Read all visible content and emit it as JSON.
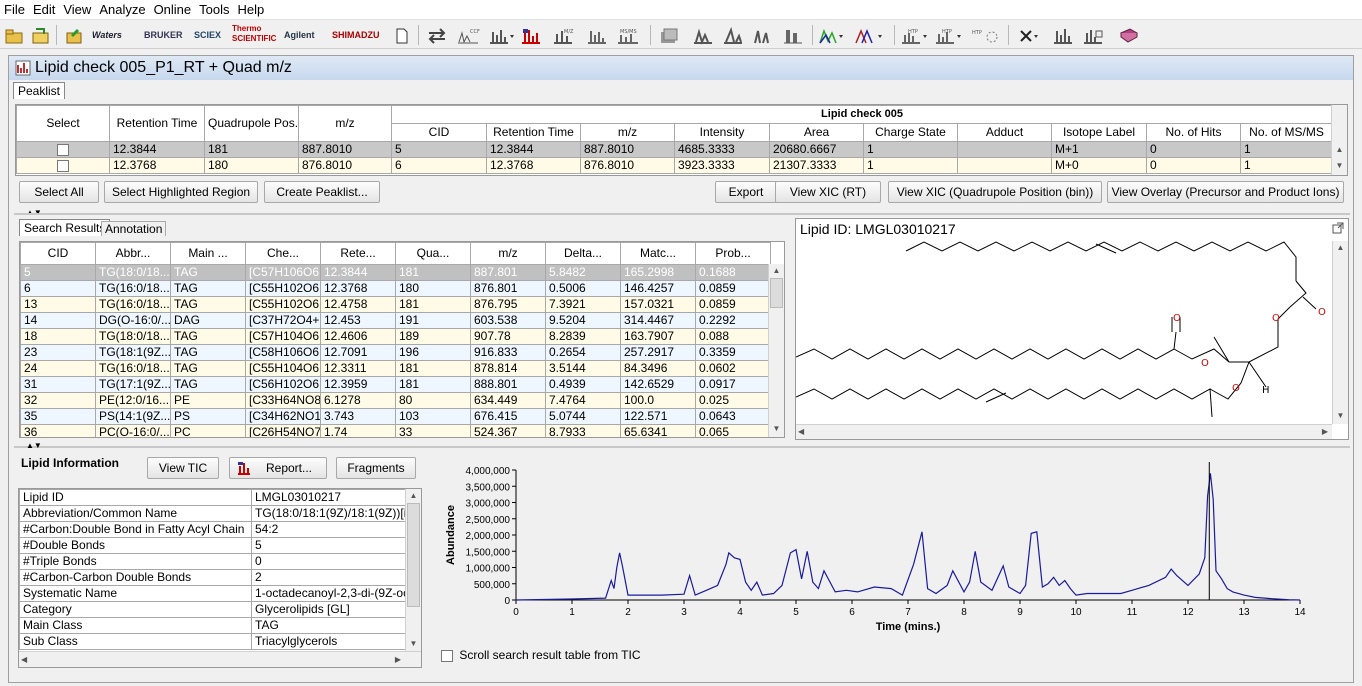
{
  "menu": [
    "File",
    "Edit",
    "View",
    "Analyze",
    "Online",
    "Tools",
    "Help"
  ],
  "toolbar": {
    "waters": "Waters",
    "bruker": "BRUKER",
    "sciex": "SCIEX",
    "thermo": "Thermo SCIENTIFIC",
    "agilent": "Agilent",
    "shimadzu": "SHIMADZU",
    "ccf": "CCF",
    "ms2": "M/Z",
    "msms": "MS/MS",
    "htp1": "HTP",
    "htp2": "HTP",
    "htp3": "HTP"
  },
  "window": {
    "title": "Lipid check 005_P1_RT + Quad m/z",
    "tab": "Peaklist"
  },
  "peaklist": {
    "left_headers": [
      "Select",
      "Retention Time",
      "Quadrupole Pos...",
      "m/z"
    ],
    "group_title": "Lipid check 005",
    "group_headers": [
      "CID",
      "Retention Time",
      "m/z",
      "Intensity",
      "Area",
      "Charge State",
      "Adduct",
      "Isotope Label",
      "No. of Hits",
      "No. of MS/MS"
    ],
    "rows": [
      [
        "12.3844",
        "181",
        "887.8010",
        "5",
        "12.3844",
        "887.8010",
        "4685.3333",
        "20680.6667",
        "1",
        "",
        "M+1",
        "0",
        "1"
      ],
      [
        "12.3768",
        "180",
        "876.8010",
        "6",
        "12.3768",
        "876.8010",
        "3923.3333",
        "21307.3333",
        "1",
        "",
        "M+0",
        "0",
        "1"
      ]
    ]
  },
  "buttons": {
    "select_all": "Select All",
    "select_region": "Select Highlighted Region",
    "create_peaklist": "Create Peaklist...",
    "export": "Export",
    "view_xic_rt": "View XIC (RT)",
    "view_xic_quad": "View XIC (Quadrupole Position (bin))",
    "view_overlay": "View Overlay (Precursor and Product Ions)",
    "view_tic": "View TIC",
    "report": "Report...",
    "fragments": "Fragments"
  },
  "results": {
    "tabs": [
      "Search Results",
      "Annotation"
    ],
    "headers": [
      "CID",
      "Abbr...",
      "Main ...",
      "Che...",
      "Rete...",
      "Qua...",
      "m/z",
      "Delta...",
      "Matc...",
      "Prob..."
    ],
    "rows": [
      [
        "5",
        "TG(18:0/18...",
        "TAG",
        "[C57H106O6",
        "12.3844",
        "181",
        "887.801",
        "5.8482",
        "165.2998",
        "0.1688"
      ],
      [
        "6",
        "TG(16:0/18...",
        "TAG",
        "[C55H102O6",
        "12.3768",
        "180",
        "876.801",
        "0.5006",
        "146.4257",
        "0.0859"
      ],
      [
        "13",
        "TG(16:0/18...",
        "TAG",
        "[C55H102O6",
        "12.4758",
        "181",
        "876.795",
        "7.3921",
        "157.0321",
        "0.0859"
      ],
      [
        "14",
        "DG(O-16:0/...",
        "DAG",
        "[C37H72O4+",
        "12.453",
        "191",
        "603.538",
        "9.5204",
        "314.4467",
        "0.2292"
      ],
      [
        "18",
        "TG(18:0/18...",
        "TAG",
        "[C57H104O6",
        "12.4606",
        "189",
        "907.78",
        "8.2839",
        "163.7907",
        "0.088"
      ],
      [
        "23",
        "TG(18:1(9Z...",
        "TAG",
        "[C58H106O6",
        "12.7091",
        "196",
        "916.833",
        "0.2654",
        "257.2917",
        "0.3359"
      ],
      [
        "24",
        "TG(16:0/18...",
        "TAG",
        "[C55H104O6",
        "12.3311",
        "181",
        "878.814",
        "3.5144",
        "84.3496",
        "0.0602"
      ],
      [
        "31",
        "TG(17:1(9Z...",
        "TAG",
        "[C56H102O6",
        "12.3959",
        "181",
        "888.801",
        "0.4939",
        "142.6529",
        "0.0917"
      ],
      [
        "32",
        "PE(12:0/16...",
        "PE",
        "[C33H64NO8",
        "6.1278",
        "80",
        "634.449",
        "7.4764",
        "100.0",
        "0.025"
      ],
      [
        "35",
        "PS(14:1(9Z...",
        "PS",
        "[C34H62NO1",
        "3.743",
        "103",
        "676.415",
        "5.0744",
        "122.571",
        "0.0643"
      ],
      [
        "36",
        "PC(O-16:0/...",
        "PC",
        "[C26H54NO7",
        "1.74",
        "33",
        "524.367",
        "8.7933",
        "65.6341",
        "0.065"
      ]
    ]
  },
  "structure": {
    "title": "Lipid ID: LMGL03010217",
    "o": "O",
    "h": "H"
  },
  "lipid_info": {
    "title": "Lipid Information",
    "rows": [
      [
        "Lipid ID",
        "LMGL03010217"
      ],
      [
        "Abbreviation/Common Name",
        "TG(18:0/18:1(9Z)/18:1(9Z))[i"
      ],
      [
        "#Carbon:Double Bond in Fatty Acyl Chain",
        "54:2"
      ],
      [
        "#Double Bonds",
        "5"
      ],
      [
        "#Triple Bonds",
        "0"
      ],
      [
        "#Carbon-Carbon Double Bonds",
        "2"
      ],
      [
        "Systematic Name",
        "1-octadecanoyl-2,3-di-(9Z-oc"
      ],
      [
        "Category",
        "Glycerolipids [GL]"
      ],
      [
        "Main Class",
        "TAG"
      ],
      [
        "Sub Class",
        "Triacylglycerols"
      ]
    ]
  },
  "chart_data": {
    "type": "line",
    "xlabel": "Time (mins.)",
    "ylabel": "Abundance",
    "xlim": [
      0,
      14
    ],
    "ylim": [
      0,
      4000000
    ],
    "xticks": [
      "0",
      "1",
      "2",
      "3",
      "4",
      "5",
      "6",
      "7",
      "8",
      "9",
      "10",
      "11",
      "12",
      "13",
      "14"
    ],
    "yticks": [
      "0",
      "500,000",
      "1,000,000",
      "1,500,000",
      "2,000,000",
      "2,500,000",
      "3,000,000",
      "3,500,000",
      "4,000,000"
    ],
    "series": [
      {
        "x": [
          0.0,
          1.0,
          1.6,
          1.7,
          1.75,
          1.8,
          1.85,
          1.9,
          2.0,
          2.2,
          2.6,
          3.0,
          3.1,
          3.2,
          3.4,
          3.6,
          3.75,
          3.8,
          3.9,
          4.0,
          4.1,
          4.2,
          4.3,
          4.4,
          4.6,
          4.75,
          4.9,
          5.0,
          5.1,
          5.2,
          5.3,
          5.4,
          5.5,
          5.7,
          5.9,
          6.1,
          6.4,
          6.7,
          6.9,
          7.1,
          7.25,
          7.35,
          7.5,
          7.7,
          7.8,
          8.0,
          8.1,
          8.2,
          8.3,
          8.5,
          8.7,
          8.8,
          9.0,
          9.1,
          9.2,
          9.3,
          9.4,
          9.5,
          9.6,
          9.7,
          9.8,
          9.9,
          10.0,
          10.2,
          10.5,
          10.8,
          11.0,
          11.3,
          11.6,
          11.7,
          11.8,
          12.0,
          12.2,
          12.3,
          12.35,
          12.4,
          12.45,
          12.5,
          12.6,
          12.7,
          12.8,
          13.0,
          13.2,
          13.5,
          13.8,
          14.0
        ],
        "values": [
          0,
          30000,
          60000,
          600000,
          350000,
          1000000,
          1450000,
          1050000,
          150000,
          150000,
          150000,
          180000,
          750000,
          150000,
          300000,
          450000,
          1100000,
          1450000,
          1300000,
          1250000,
          550000,
          300000,
          550000,
          150000,
          200000,
          450000,
          1450000,
          1550000,
          650000,
          1500000,
          550000,
          350000,
          900000,
          250000,
          300000,
          250000,
          400000,
          350000,
          150000,
          1100000,
          2100000,
          350000,
          200000,
          450000,
          900000,
          250000,
          550000,
          1500000,
          550000,
          300000,
          1050000,
          400000,
          200000,
          450000,
          2050000,
          2100000,
          400000,
          500000,
          700000,
          450000,
          600000,
          350000,
          150000,
          200000,
          200000,
          200000,
          300000,
          450000,
          700000,
          950000,
          750000,
          450000,
          800000,
          1300000,
          3200000,
          3900000,
          3100000,
          900000,
          650000,
          350000,
          250000,
          150000,
          80000,
          40000,
          10000,
          0
        ]
      }
    ],
    "cursor_x": 12.38
  },
  "footer": {
    "scroll_label": "Scroll search result table from TIC"
  }
}
